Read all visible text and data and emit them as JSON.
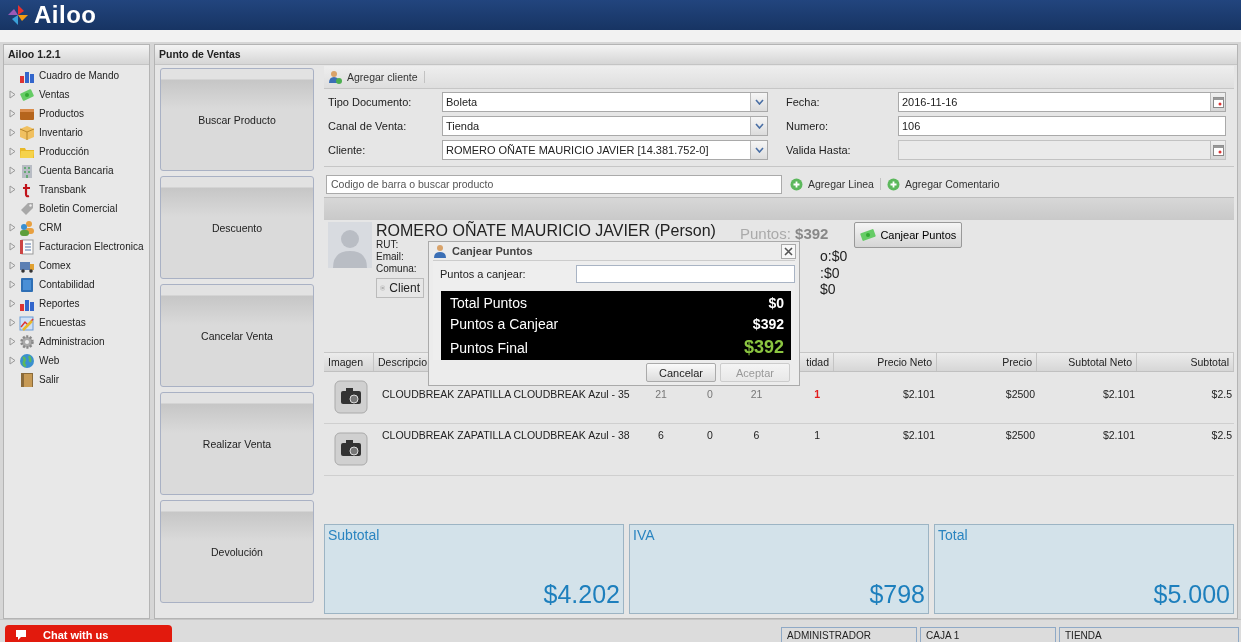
{
  "header": {
    "logo": "Ailoo"
  },
  "sidebar": {
    "title": "Ailoo 1.2.1",
    "items": [
      {
        "label": "Cuadro de Mando",
        "expandable": false
      },
      {
        "label": "Ventas",
        "expandable": true
      },
      {
        "label": "Productos",
        "expandable": true
      },
      {
        "label": "Inventario",
        "expandable": true
      },
      {
        "label": "Producción",
        "expandable": true
      },
      {
        "label": "Cuenta Bancaria",
        "expandable": true
      },
      {
        "label": "Transbank",
        "expandable": true
      },
      {
        "label": "Boletin Comercial",
        "expandable": false
      },
      {
        "label": "CRM",
        "expandable": true
      },
      {
        "label": "Facturacion Electronica",
        "expandable": true
      },
      {
        "label": "Comex",
        "expandable": true
      },
      {
        "label": "Contabilidad",
        "expandable": true
      },
      {
        "label": "Reportes",
        "expandable": true
      },
      {
        "label": "Encuestas",
        "expandable": true
      },
      {
        "label": "Administracion",
        "expandable": true
      },
      {
        "label": "Web",
        "expandable": true
      },
      {
        "label": "Salir",
        "expandable": false
      }
    ]
  },
  "panel": {
    "title": "Punto de Ventas"
  },
  "actions": [
    "Buscar Producto",
    "Descuento",
    "Cancelar Venta",
    "Realizar Venta",
    "Devolución"
  ],
  "toolbar": {
    "add_client": "Agregar cliente"
  },
  "form": {
    "left": [
      {
        "label": "Tipo Documento:",
        "value": "Boleta",
        "kind": "select",
        "disabled": false
      },
      {
        "label": "Canal de Venta:",
        "value": "Tienda",
        "kind": "select",
        "disabled": false
      },
      {
        "label": "Cliente:",
        "value": "ROMERO OÑATE MAURICIO JAVIER [14.381.752-0]",
        "kind": "select",
        "disabled": false
      }
    ],
    "right": [
      {
        "label": "Fecha:",
        "value": "2016-11-16",
        "kind": "date",
        "disabled": false
      },
      {
        "label": "Numero:",
        "value": "106",
        "kind": "text",
        "disabled": false
      },
      {
        "label": "Valida Hasta:",
        "kind": "date",
        "disabled": true
      }
    ]
  },
  "search": {
    "placeholder": "Codigo de barra o buscar producto",
    "buttons": [
      "Agregar Linea",
      "Agregar Comentario"
    ]
  },
  "client": {
    "name": "ROMERO OÑATE MAURICIO JAVIER (Person)",
    "fields": [
      "RUT:",
      "Email:",
      "Comuna:"
    ],
    "points": "Puntos: **$392**",
    "redeem_button": "Canjear Puntos",
    "chip": "Client",
    "summary": [
      "o:$0",
      ":$0",
      "$0"
    ]
  },
  "table": {
    "columns": [
      "Imagen",
      "Descripcio",
      "",
      "",
      "",
      "tidad",
      "Precio Neto",
      "Precio",
      "Subtotal Neto",
      "Subtotal"
    ],
    "rows": [
      {
        "cells": [
          "",
          "CLOUDBREAK ZAPATILLA CLOUDBREAK Azul - 35",
          "21",
          "0",
          "21",
          "1",
          "$2.101",
          "$2500",
          "$2.101",
          "$2.5"
        ],
        "stock_warning": true
      },
      {
        "cells": [
          "",
          "CLOUDBREAK ZAPATILLA CLOUDBREAK Azul - 38",
          "6",
          "0",
          "6",
          "1",
          "$2.101",
          "$2500",
          "$2.101",
          "$2.5"
        ],
        "stock_warning": false
      }
    ]
  },
  "totals": [
    {
      "label": "Subtotal",
      "value": "$4.202"
    },
    {
      "label": "IVA",
      "value": "$798"
    },
    {
      "label": "Total",
      "value": "$5.000"
    }
  ],
  "dialog": {
    "title": "Canjear Puntos",
    "field_label": "Puntos a canjear:",
    "summary": [
      {
        "label": "Total Puntos",
        "value": "$0",
        "highlight": false
      },
      {
        "label": "Puntos a Canjear",
        "value": "$392",
        "highlight": false
      },
      {
        "label": "Puntos Final",
        "value": "$392",
        "highlight": true
      }
    ],
    "buttons": [
      {
        "label": "Cancelar",
        "disabled": false
      },
      {
        "label": "Aceptar",
        "disabled": true
      }
    ]
  },
  "status_bar": {
    "chat": "Chat with us",
    "cells": [
      "ADMINISTRADOR",
      "CAJA 1",
      "TIENDA"
    ]
  }
}
